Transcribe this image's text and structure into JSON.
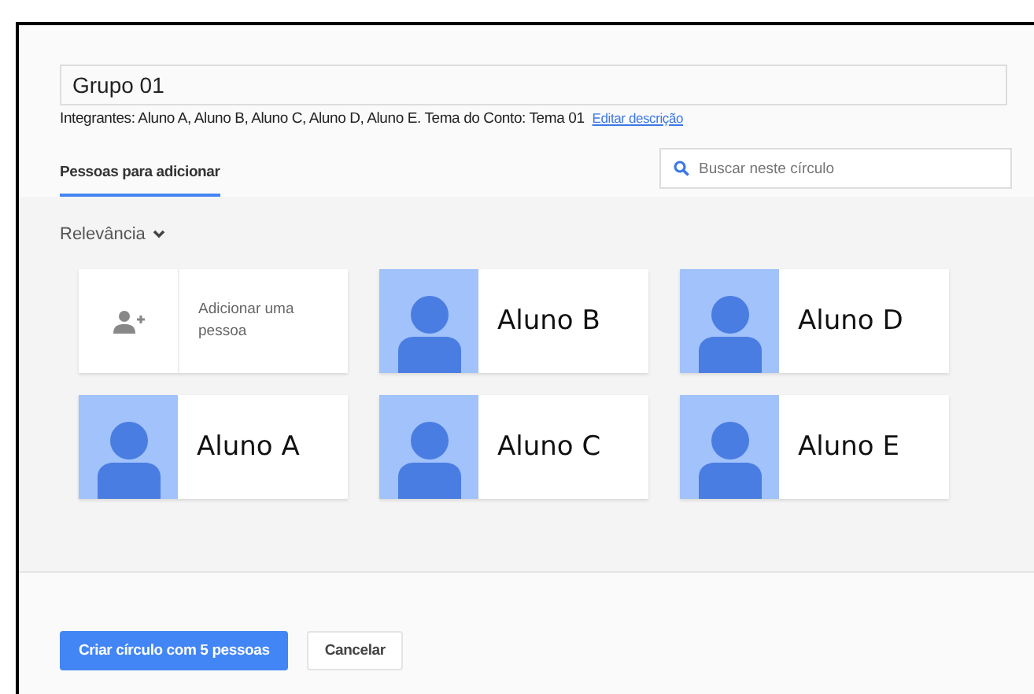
{
  "circle_name": {
    "value": "Grupo 01"
  },
  "description": {
    "text": "Integrantes: Aluno A, Aluno B, Aluno C, Aluno D, Aluno E. Tema do Conto: Tema 01",
    "edit_link": "Editar descrição"
  },
  "tabs": [
    {
      "label": "Pessoas para adicionar",
      "selected": true
    }
  ],
  "search": {
    "placeholder": "Buscar neste círculo"
  },
  "sort": {
    "label": "Relevância"
  },
  "cards": [
    {
      "kind": "add",
      "label": "Adicionar uma pessoa"
    },
    {
      "kind": "person",
      "name": "Aluno B"
    },
    {
      "kind": "person",
      "name": "Aluno D"
    },
    {
      "kind": "person",
      "name": "Aluno A"
    },
    {
      "kind": "person",
      "name": "Aluno C"
    },
    {
      "kind": "person",
      "name": "Aluno E"
    }
  ],
  "buttons": [
    {
      "kind": "primary",
      "label": "Criar círculo com 5 pessoas"
    },
    {
      "kind": "secondary",
      "label": "Cancelar"
    }
  ]
}
